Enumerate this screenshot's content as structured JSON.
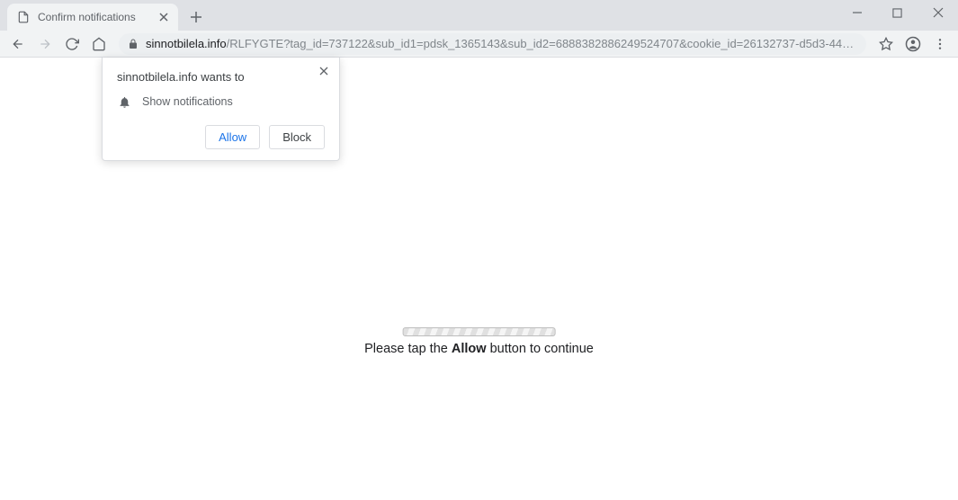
{
  "window": {
    "tab_title": "Confirm notifications"
  },
  "toolbar": {
    "url_domain": "sinnotbilela.info",
    "url_path": "/RLFYGTE?tag_id=737122&sub_id1=pdsk_1365143&sub_id2=6888382886249524707&cookie_id=26132737-d5d3-4431-8b75-45136b1b94b1&lp..."
  },
  "popup": {
    "title": "sinnotbilela.info wants to",
    "permission_label": "Show notifications",
    "allow_label": "Allow",
    "block_label": "Block"
  },
  "page": {
    "msg_prefix": "Please tap the ",
    "msg_bold": "Allow",
    "msg_suffix": " button to continue"
  }
}
